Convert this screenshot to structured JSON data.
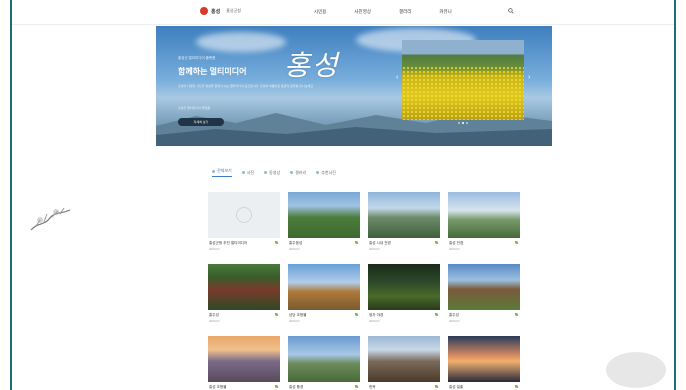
{
  "header": {
    "logo_text": "홍성",
    "logo_sub": "홍성군청",
    "nav": [
      "시민용",
      "사진영상",
      "갤러리",
      "커뮤니"
    ]
  },
  "hero": {
    "tagline": "홍성군 멀티미디어 플랫폼",
    "title": "함께하는 멀티미디어",
    "brand": "홍성",
    "description": "홍성의 다양한 사진과 영상을 함께 나누는 멀티미디어 공간입니다. 홍성의 아름다운 풍경과 문화를 만나보세요.",
    "note": "홍성군 멀티미디어 플랫폼",
    "button_label": "자세히 보기"
  },
  "tabs": [
    {
      "label": "전체보기",
      "active": true
    },
    {
      "label": "사진",
      "active": false
    },
    {
      "label": "동영상",
      "active": false
    },
    {
      "label": "갤러리",
      "active": false
    },
    {
      "label": "추천사진",
      "active": false
    }
  ],
  "cards": [
    {
      "title": "홍성군청 추천 멀티미디어",
      "date": "2023.07",
      "theme": "ph"
    },
    {
      "title": "홍주읍성",
      "date": "2023.07",
      "theme": "t1"
    },
    {
      "title": "홍성 시내 전경",
      "date": "2023.07",
      "theme": "t2"
    },
    {
      "title": "홍성 전경",
      "date": "2023.07",
      "theme": "t3"
    },
    {
      "title": "홍주성",
      "date": "2023.07",
      "theme": "t4"
    },
    {
      "title": "남당 조형물",
      "date": "2023.07",
      "theme": "t5"
    },
    {
      "title": "정자 야경",
      "date": "2023.07",
      "theme": "t6"
    },
    {
      "title": "홍주성",
      "date": "2023.07",
      "theme": "t7"
    },
    {
      "title": "홍성 조형물",
      "date": "2023.07",
      "theme": "t8"
    },
    {
      "title": "홍성 풍경",
      "date": "2023.07",
      "theme": "t9"
    },
    {
      "title": "한옥",
      "date": "2023.07",
      "theme": "t10"
    },
    {
      "title": "홍성 일출",
      "date": "2023.07",
      "theme": "t11"
    }
  ]
}
